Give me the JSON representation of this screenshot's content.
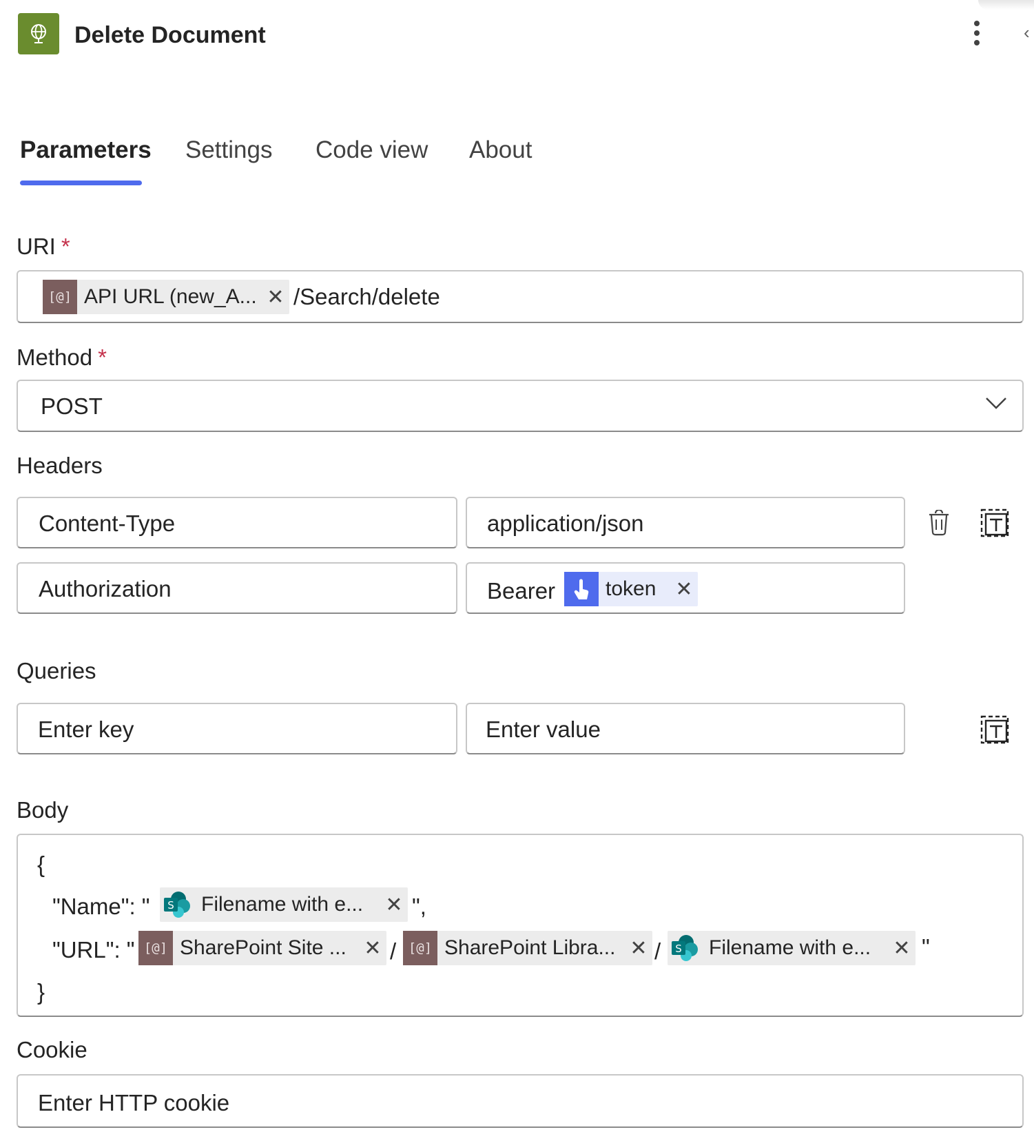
{
  "header": {
    "title": "Delete Document",
    "icon": "globe-icon",
    "more_icon": "more-vertical-icon"
  },
  "tabs": [
    {
      "label": "Parameters",
      "active": true
    },
    {
      "label": "Settings",
      "active": false
    },
    {
      "label": "Code view",
      "active": false
    },
    {
      "label": "About",
      "active": false
    }
  ],
  "uri": {
    "label": "URI",
    "required_mark": "*",
    "token": {
      "icon_text": "[@]",
      "label": "API URL (new_A...",
      "remove": "✕"
    },
    "suffix": "/Search/delete"
  },
  "method": {
    "label": "Method",
    "required_mark": "*",
    "value": "POST"
  },
  "headers": {
    "label": "Headers",
    "rows": [
      {
        "key": "Content-Type",
        "value": "application/json"
      },
      {
        "key": "Authorization",
        "value_prefix": "Bearer",
        "token": {
          "label": "token",
          "remove": "✕"
        }
      }
    ]
  },
  "queries": {
    "label": "Queries",
    "key_placeholder": "Enter key",
    "value_placeholder": "Enter value"
  },
  "body": {
    "label": "Body",
    "open_brace": "{",
    "close_brace": "}",
    "name_prefix": "\"Name\": \"",
    "name_token": {
      "label": "Filename with e...",
      "remove": "✕"
    },
    "name_suffix": "\",",
    "url_prefix": "\"URL\": \"",
    "url_token_site": {
      "icon_text": "[@]",
      "label": "SharePoint Site ...",
      "remove": "✕"
    },
    "separator": "/",
    "url_token_library": {
      "icon_text": "[@]",
      "label": "SharePoint Libra...",
      "remove": "✕"
    },
    "url_token_file": {
      "label": "Filename with e...",
      "remove": "✕"
    },
    "url_suffix": "\""
  },
  "cookie": {
    "label": "Cookie",
    "placeholder": "Enter HTTP cookie"
  },
  "colors": {
    "accent": "#4f6bed",
    "app_icon": "#6a8c2e",
    "variable_token": "#7b5e5e",
    "required": "#c4314b"
  }
}
